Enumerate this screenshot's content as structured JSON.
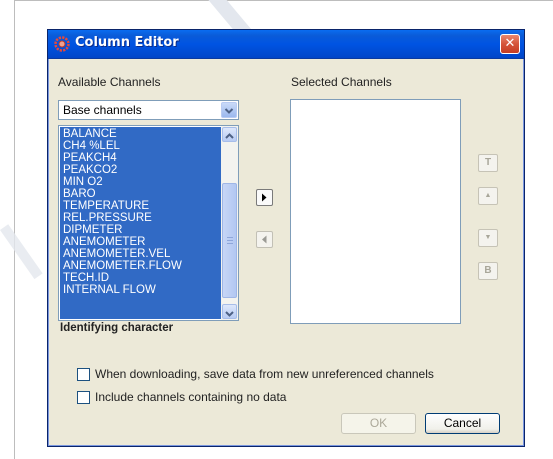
{
  "window": {
    "title": "Column Editor",
    "close_symbol": "✕",
    "icon": "app-gear-icon"
  },
  "available": {
    "label": "Available Channels",
    "dropdown_value": "Base channels",
    "items": [
      "BALANCE",
      "CH4 %LEL",
      "PEAKCH4",
      "PEAKCO2",
      "MIN O2",
      "BARO",
      "TEMPERATURE",
      "REL.PRESSURE",
      "DIPMETER",
      "ANEMOMETER",
      "ANEMOMETER.VEL",
      "ANEMOMETER.FLOW",
      "TECH.ID",
      "INTERNAL FLOW"
    ]
  },
  "selected": {
    "label": "Selected Channels"
  },
  "identifying_label": "Identifying character",
  "side_buttons": {
    "top": "T",
    "up": "▲",
    "down": "▼",
    "bottom": "B"
  },
  "options": {
    "save_new_channels": {
      "label": "When downloading, save data from new unreferenced channels",
      "checked": false
    },
    "include_empty": {
      "label": "Include channels containing no data",
      "checked": false
    }
  },
  "buttons": {
    "ok": "OK",
    "cancel": "Cancel"
  },
  "colors": {
    "titlebar": "#0054e3",
    "selection": "#316ac5",
    "dialog_bg": "#ece9d8",
    "close_button": "#d5553a"
  }
}
